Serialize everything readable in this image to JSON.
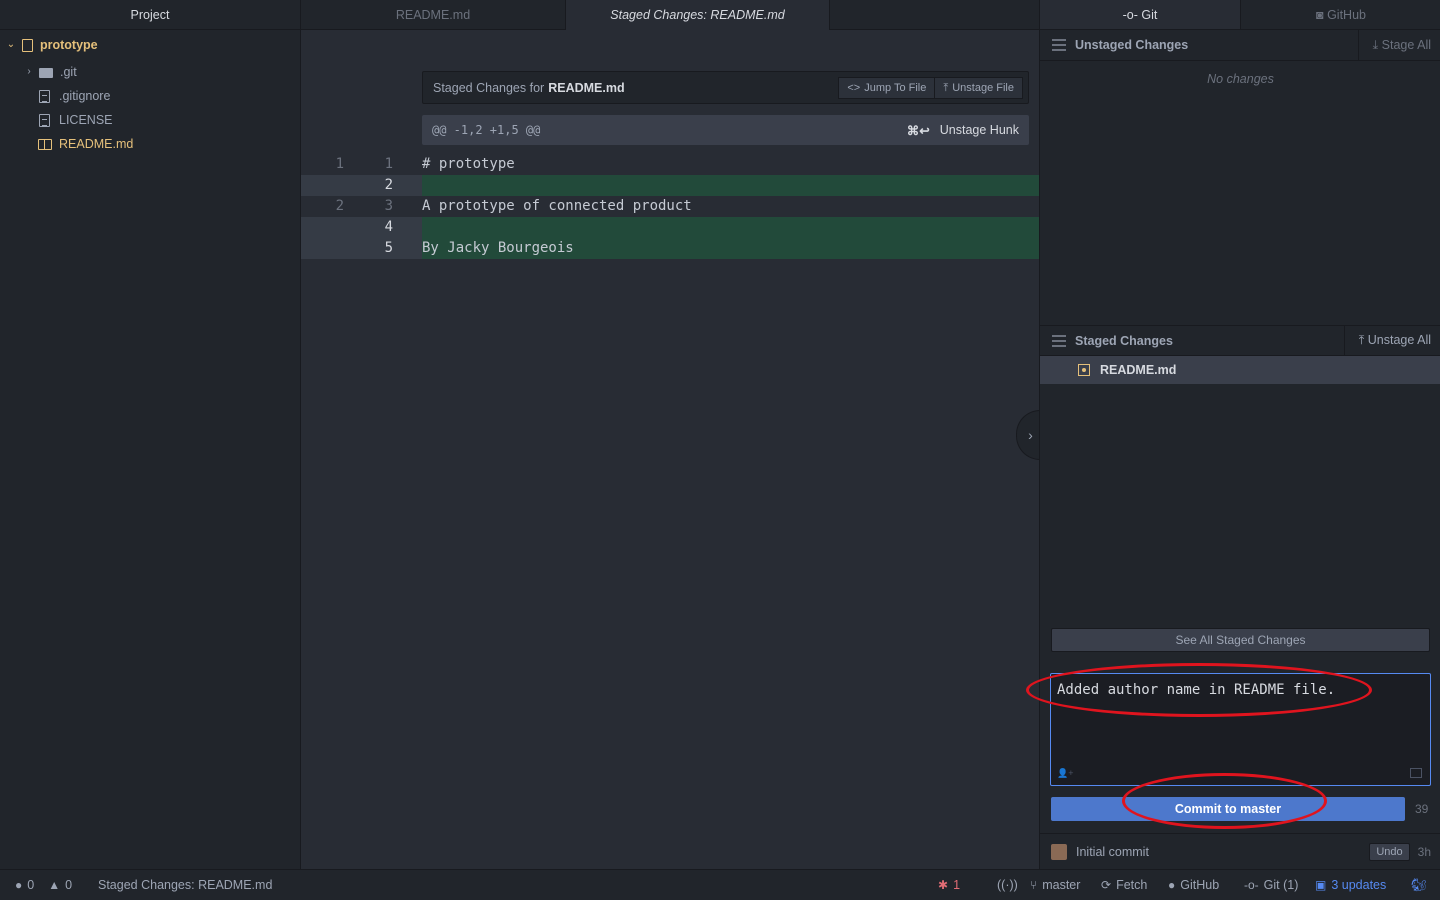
{
  "tree": {
    "title": "Project",
    "root": "prototype",
    "items": [
      {
        "label": ".git",
        "type": "folder"
      },
      {
        "label": ".gitignore",
        "type": "file"
      },
      {
        "label": "LICENSE",
        "type": "file"
      },
      {
        "label": "README.md",
        "type": "book",
        "modified": true
      }
    ]
  },
  "tabs": [
    {
      "label": "README.md",
      "active": false
    },
    {
      "label": "Staged Changes: README.md",
      "active": true
    }
  ],
  "diff": {
    "header_prefix": "Staged Changes for",
    "header_file": "README.md",
    "jump_label": "Jump To File",
    "unstage_file_label": "Unstage File",
    "hunk_range": "@@ -1,2 +1,5 @@",
    "hunk_shortcut": "⌘↩",
    "hunk_action": "Unstage Hunk",
    "lines": [
      {
        "old": "1",
        "new": "1",
        "text": "# prototype",
        "added": false
      },
      {
        "old": "",
        "new": "2",
        "text": "",
        "added": true
      },
      {
        "old": "2",
        "new": "3",
        "text": "A prototype of connected product",
        "added": false
      },
      {
        "old": "",
        "new": "4",
        "text": "",
        "added": true
      },
      {
        "old": "",
        "new": "5",
        "text": "By Jacky Bourgeois",
        "added": true
      }
    ],
    "collapse_icon": "›"
  },
  "git": {
    "tab_git": "Git",
    "tab_github": "GitHub",
    "unstaged_title": "Unstaged Changes",
    "stage_all": "Stage All",
    "no_changes": "No changes",
    "staged_title": "Staged Changes",
    "unstage_all": "Unstage All",
    "staged_file": "README.md",
    "see_all": "See All Staged Changes",
    "commit_message": "Added author name in README file.",
    "commit_button": "Commit to master",
    "remaining_chars": "39",
    "recent_commit": "Initial commit",
    "undo": "Undo",
    "commit_age": "3h"
  },
  "status": {
    "errors": "0",
    "warnings": "0",
    "file": "Staged Changes: README.md",
    "bugs": "1",
    "branch": "master",
    "fetch": "Fetch",
    "github": "GitHub",
    "git": "Git (1)",
    "updates": "3 updates"
  },
  "colors": {
    "accent": "#4d78cc",
    "added_line": "#224a3a",
    "modified": "#e5c07b",
    "annotation": "#e0141e"
  }
}
